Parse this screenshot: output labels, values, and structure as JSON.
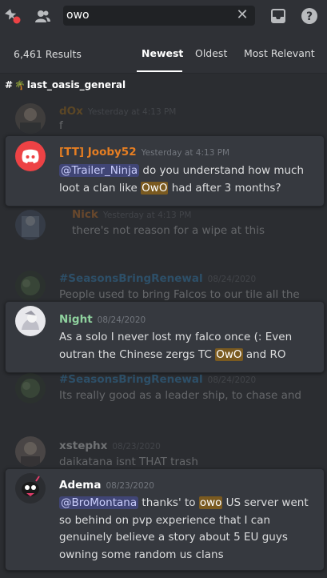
{
  "toolbar": {
    "search_value": "owo",
    "icons": [
      "pin-icon",
      "members-icon",
      "close-icon",
      "inbox-icon",
      "help-icon"
    ]
  },
  "results": {
    "count": "6,461 Results",
    "tabs": [
      "Newest",
      "Oldest",
      "Most Relevant"
    ],
    "active_tab": "Newest"
  },
  "channel": {
    "prefix": "#",
    "emoji": "🌴",
    "name": "last_oasis_general"
  },
  "messages": [
    {
      "user": "dOx",
      "user_color": "#c27c0e",
      "time": "Yesterday at 4:13 PM",
      "text": "f",
      "context": true
    },
    {
      "user": "[TT] Jooby52",
      "user_color": "#e67e22",
      "time": "Yesterday at 4:13 PM",
      "mention": "@Trailer_Ninja",
      "text_a": " do you understand how much loot a clan like ",
      "highlight": "OwO",
      "text_b": " had after 3 months?",
      "context": false
    },
    {
      "user": "Nick",
      "user_color": "#e67e22",
      "time": "Yesterday at 4:13 PM",
      "text": "there's not reason for a wipe at this",
      "context": true
    },
    {
      "user": "#SeasonsBringRenewal",
      "user_color": "#3498db",
      "time": "08/24/2020",
      "text": "People used to bring Falcos to our tile all the",
      "context": true
    },
    {
      "user": "Night",
      "user_color": "#8fd19e",
      "time": "08/24/2020",
      "text_a": "As a solo I never lost my falco once (: Even outran the Chinese zergs TC ",
      "highlight": "OwO",
      "text_b": " and RO",
      "context": false
    },
    {
      "user": "#SeasonsBringRenewal",
      "user_color": "#3498db",
      "time": "08/24/2020",
      "text": "Its really good as a leader ship, to chase and",
      "context": true
    },
    {
      "user": "xstephx",
      "user_color": "#ffffff",
      "time": "08/23/2020",
      "text": "daikatana isnt THAT trash",
      "context": true
    },
    {
      "user": "Adema",
      "user_color": "#ffffff",
      "time": "08/23/2020",
      "mention": "@BroMontana",
      "text_a": " thanks' to ",
      "highlight": "owo",
      "text_b": " US server went so behind on pvp experience that I can genuinely believe a story about 5 EU guys owning some random us clans",
      "context": false
    }
  ]
}
